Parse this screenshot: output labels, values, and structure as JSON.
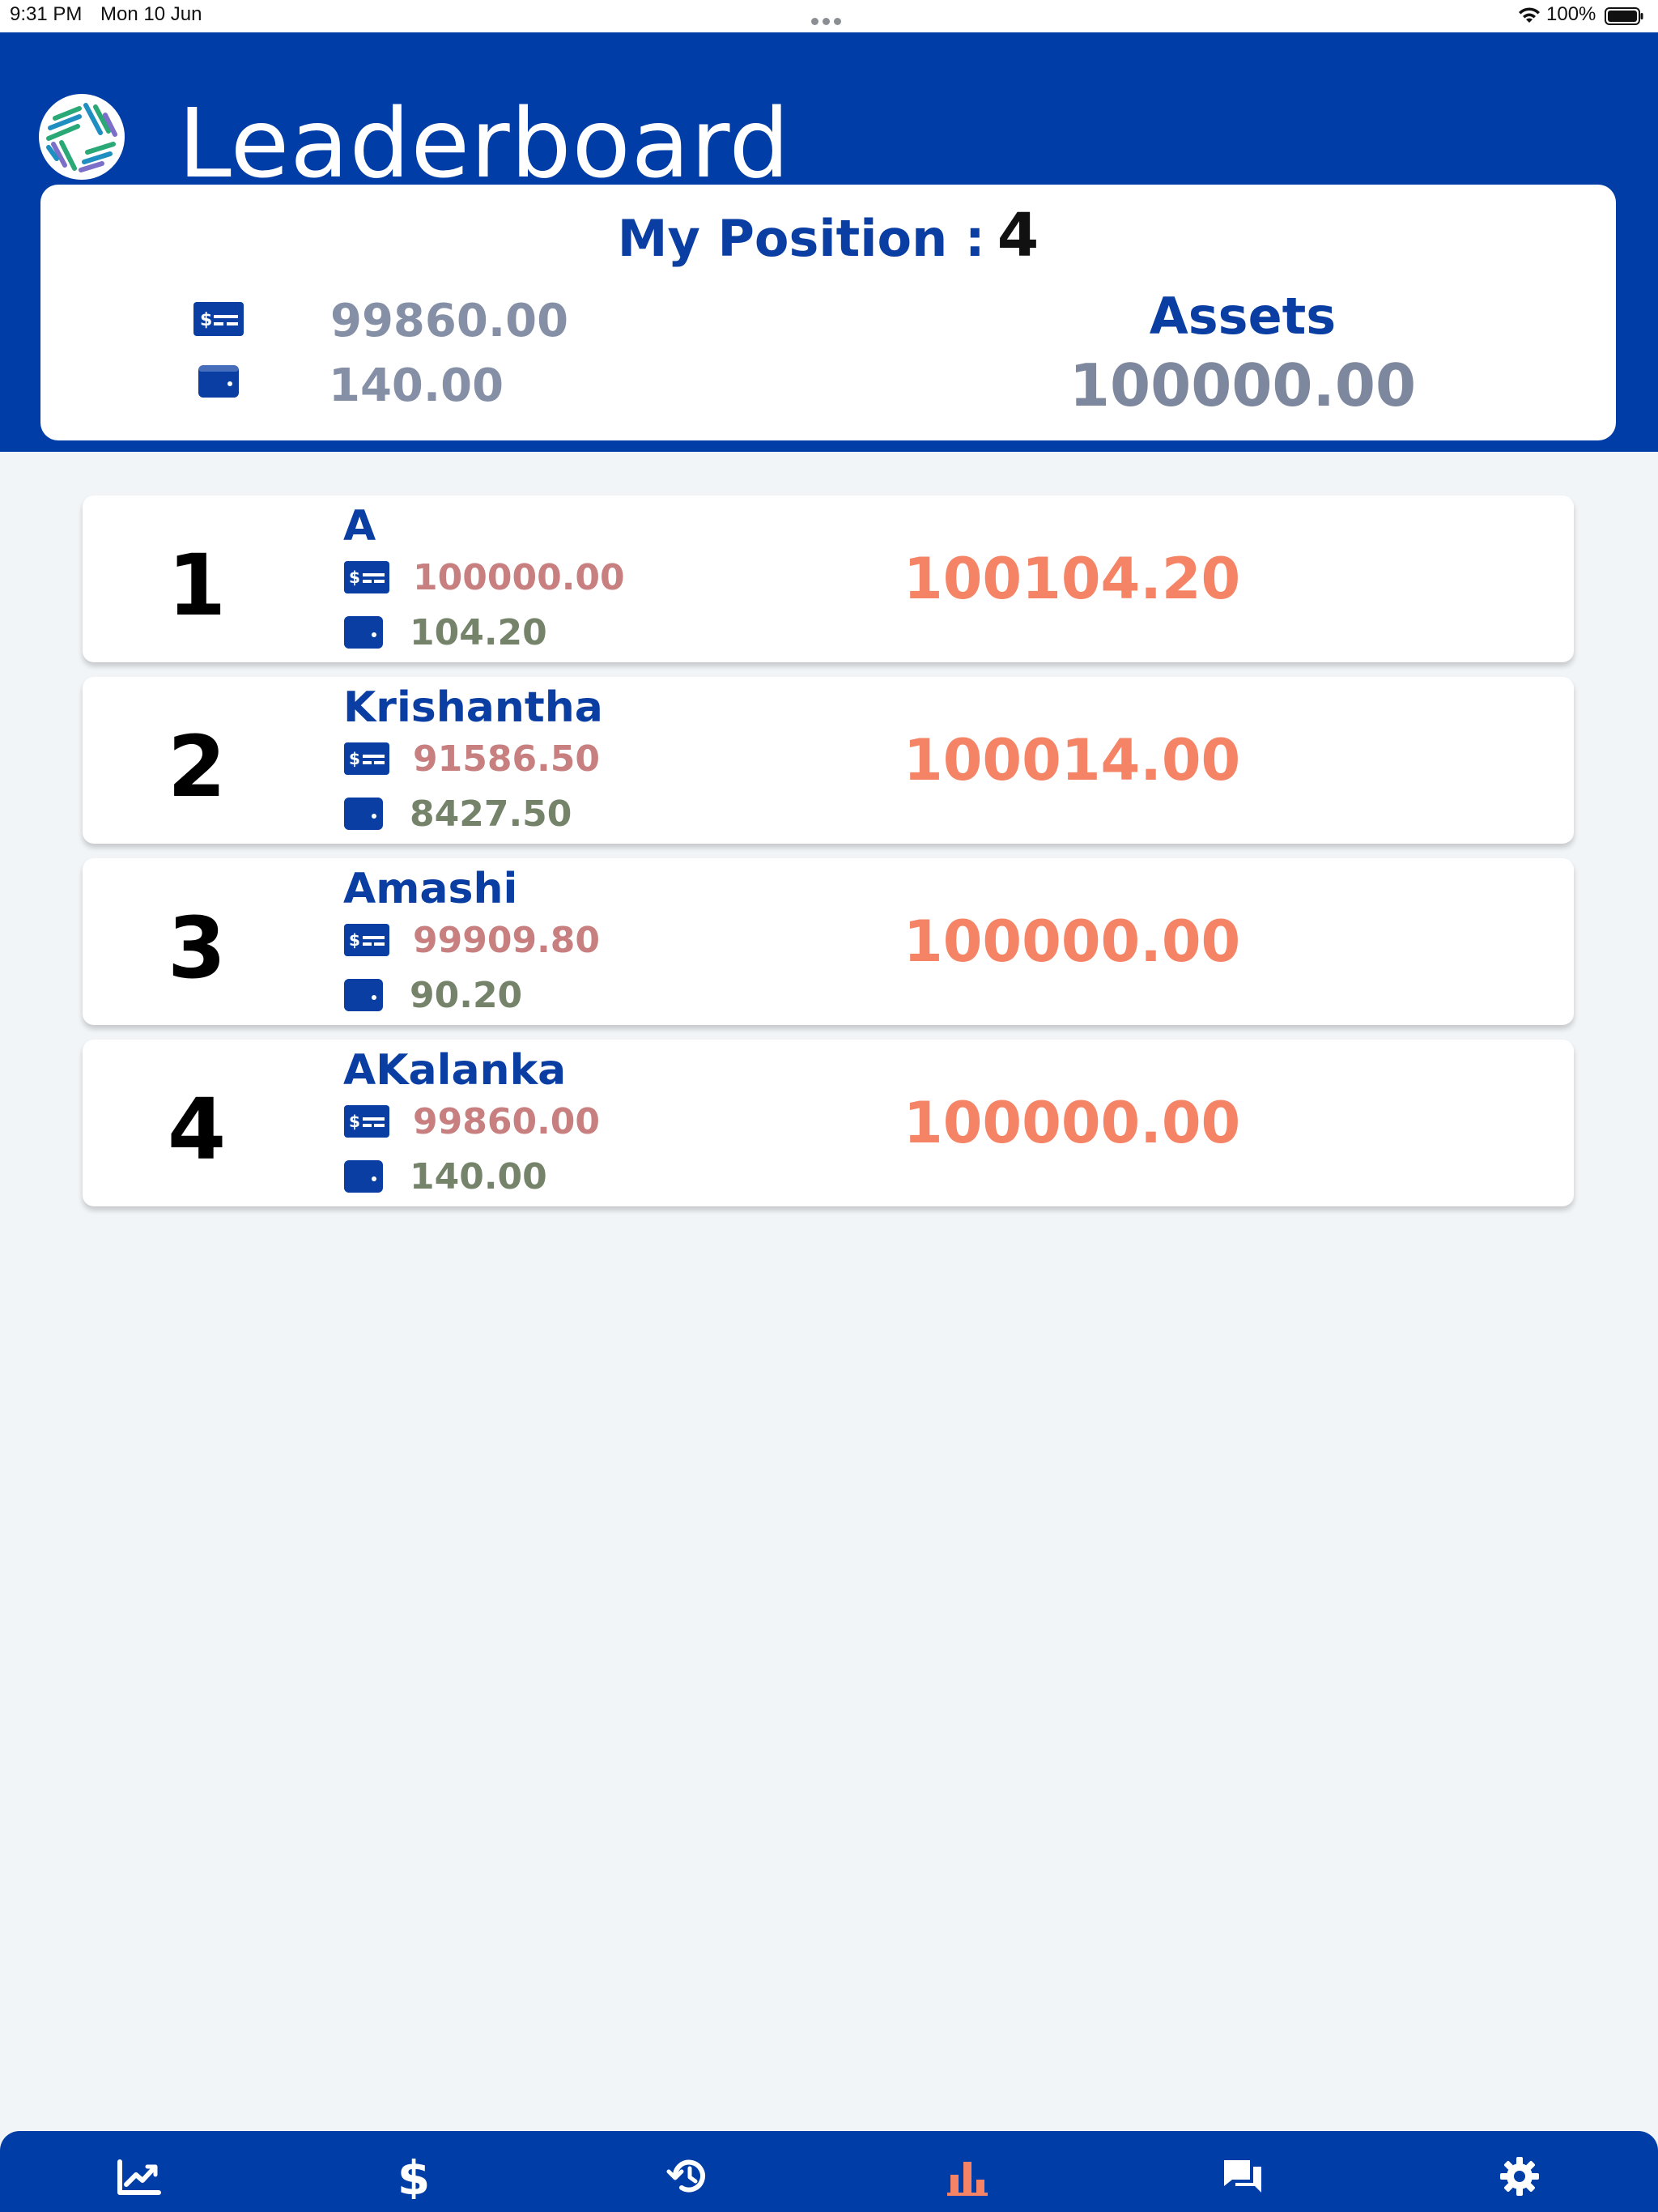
{
  "status_bar": {
    "time": "9:31 PM",
    "date": "Mon 10 Jun",
    "battery": "100%"
  },
  "header": {
    "title": "Leaderboard",
    "logo_icon": "app-logo"
  },
  "summary": {
    "position_label": "My Position :",
    "position_value": "4",
    "cash_icon": "cash-icon",
    "wallet_icon": "wallet-icon",
    "cash": "99860.00",
    "holdings": "140.00",
    "assets_label": "Assets",
    "assets": "100000.00"
  },
  "leaderboard": [
    {
      "rank": "1",
      "name": "A",
      "cash": "100000.00",
      "holdings": "104.20",
      "total": "100104.20"
    },
    {
      "rank": "2",
      "name": "Krishantha",
      "cash": "91586.50",
      "holdings": "8427.50",
      "total": "100014.00"
    },
    {
      "rank": "3",
      "name": "Amashi",
      "cash": "99909.80",
      "holdings": "90.20",
      "total": "100000.00"
    },
    {
      "rank": "4",
      "name": "AKalanka",
      "cash": "99860.00",
      "holdings": "140.00",
      "total": "100000.00"
    }
  ],
  "bottom_nav": [
    {
      "icon": "trend-chart-icon",
      "active": false
    },
    {
      "icon": "dollar-icon",
      "active": false
    },
    {
      "icon": "history-icon",
      "active": false
    },
    {
      "icon": "bar-chart-icon",
      "active": true
    },
    {
      "icon": "chat-icon",
      "active": false
    },
    {
      "icon": "settings-icon",
      "active": false
    }
  ],
  "colors": {
    "brand_blue": "#003da6",
    "name_blue": "#0a3ea3",
    "total_orange": "#f58466",
    "cash_red": "#c77f7f",
    "holdings_green": "#75836a",
    "nav_active": "#f58466",
    "nav_inactive": "#ffffff"
  }
}
